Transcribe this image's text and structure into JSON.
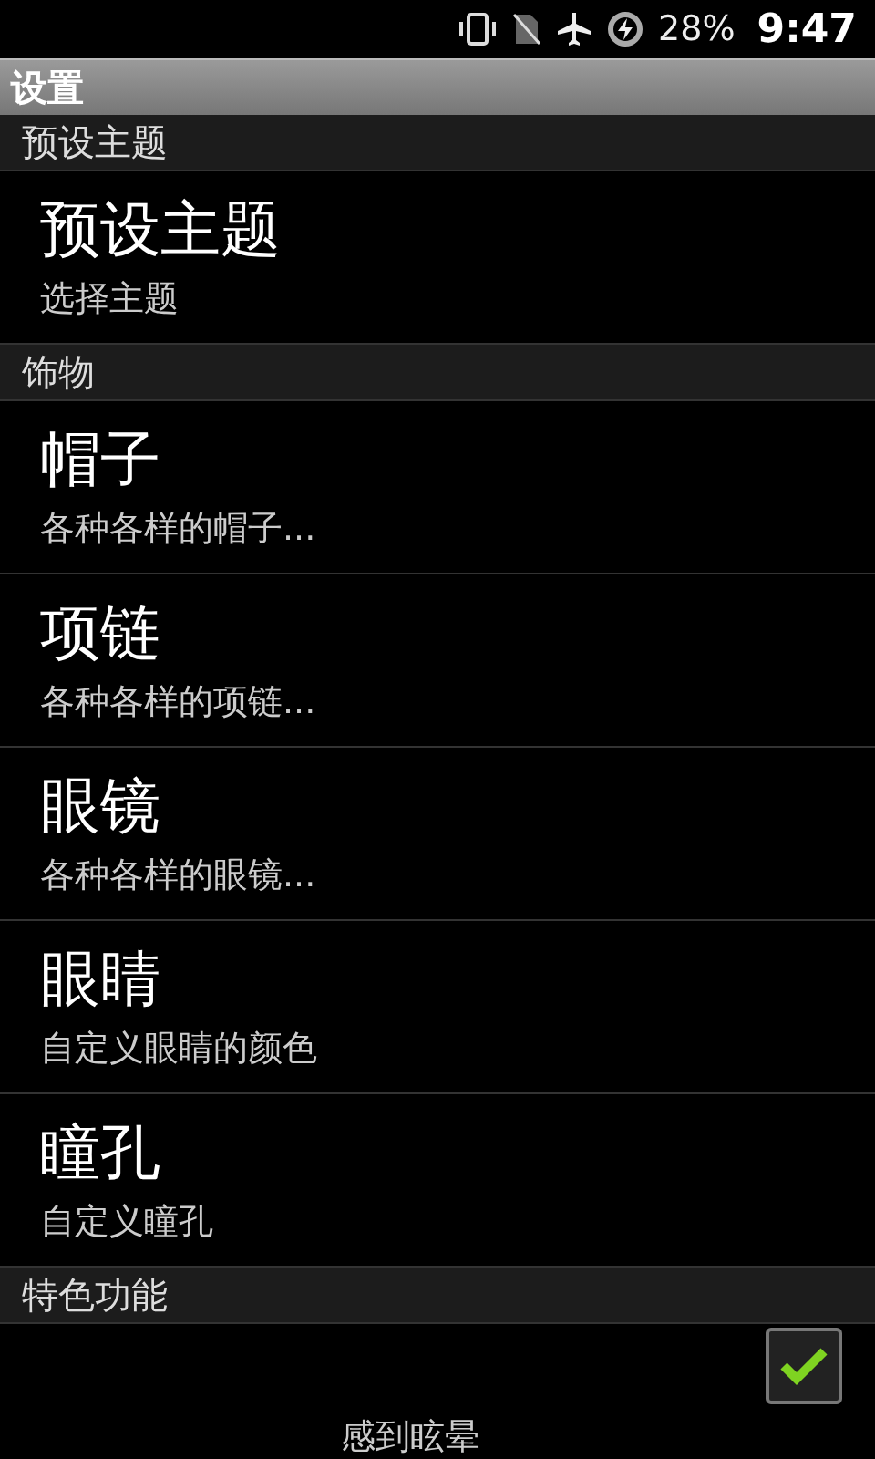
{
  "status_bar": {
    "battery": "28%",
    "time": "9:47"
  },
  "title_bar": {
    "title": "设置"
  },
  "sections": [
    {
      "header": "预设主题",
      "items": [
        {
          "kind": "plain",
          "title": "预设主题",
          "summary": "选择主题"
        }
      ]
    },
    {
      "header": "饰物",
      "items": [
        {
          "kind": "plain",
          "title": "帽子",
          "summary": "各种各样的帽子..."
        },
        {
          "kind": "plain",
          "title": "项链",
          "summary": "各种各样的项链..."
        },
        {
          "kind": "plain",
          "title": "眼镜",
          "summary": "各种各样的眼镜..."
        },
        {
          "kind": "plain",
          "title": "眼睛",
          "summary": "自定义眼睛的颜色"
        },
        {
          "kind": "plain",
          "title": "瞳孔",
          "summary": "自定义瞳孔"
        }
      ]
    },
    {
      "header": "特色功能",
      "items": [
        {
          "kind": "checkbox",
          "summary": "感到眩晕",
          "checked": true
        }
      ]
    }
  ]
}
